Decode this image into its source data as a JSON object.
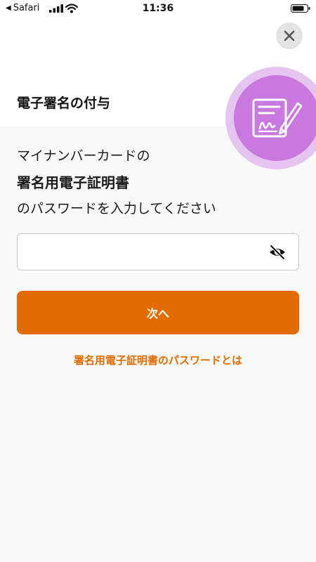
{
  "status_bar": {
    "back_label": "Safari",
    "time": "11:36"
  },
  "header": {
    "title": "電子署名の付与"
  },
  "icons": {
    "close": "close-icon",
    "badge": "signature-document-icon",
    "password_toggle": "eye-slash-icon"
  },
  "prompt": {
    "line1": "マイナンバーカードの",
    "line2": "署名用電子証明書",
    "line3": "のパスワードを入力してください"
  },
  "password_field": {
    "value": "",
    "placeholder": ""
  },
  "next_button": {
    "label": "次へ"
  },
  "help_link": {
    "label": "署名用電子証明書のパスワードとは"
  },
  "colors": {
    "accent": "#e36c00",
    "badge_outer": "#e6c4f0",
    "badge_inner": "#c978e0",
    "close_bg": "#e3e3e3",
    "page_bg": "#f9f9f9"
  }
}
